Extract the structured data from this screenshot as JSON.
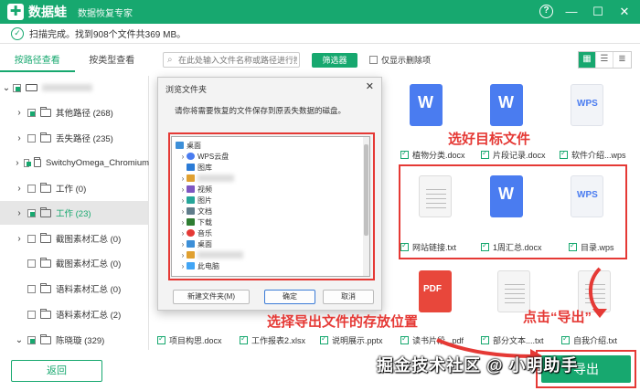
{
  "app": {
    "brand": "数据蛙",
    "subtitle": "数据恢复专家",
    "logo_glyph": "✚",
    "accent_color": "#17a86f",
    "window_buttons": [
      "?",
      "—",
      "☐",
      "✕"
    ]
  },
  "status": {
    "text": "扫描完成。找到908个文件共369 MB。"
  },
  "tabs": [
    "按路径查看",
    "按类型查看"
  ],
  "toolbar": {
    "search_placeholder": "在此处输入文件名称或路径进行搜索",
    "filter_label": "筛选器",
    "only_deleted_label": "仅显示删除项",
    "view_icons": [
      "grid-view-icon",
      "list-view-icon",
      "detail-view-icon"
    ]
  },
  "sidebar": {
    "items": [
      {
        "label": "其他路径 (268)"
      },
      {
        "label": "丢失路径 (235)"
      },
      {
        "label": "SwitchyOmega_Chromium"
      },
      {
        "label": "工作 (0)"
      },
      {
        "label": "工作 (23)"
      },
      {
        "label": "截图素材汇总 (0)"
      },
      {
        "label": "截图素材汇总 (0)"
      },
      {
        "label": "语料素材汇总 (0)"
      },
      {
        "label": "语料素材汇总 (2)"
      },
      {
        "label": "陈晓璇 (329)"
      }
    ],
    "back_label": "返回"
  },
  "files": {
    "row1_names": [
      "植物分类.docx",
      "片段记录.docx",
      "软件介绍...wps"
    ],
    "row2_names": [
      "网站链接.txt",
      "1周汇总.docx",
      "目录.wps"
    ],
    "row3_names": [
      "项目构思.docx",
      "工作报表2.xlsx",
      "说明展示.pptx",
      "读书片段...pdf",
      "部分文本....txt",
      "自我介绍.txt"
    ],
    "icon_text": {
      "wps": "WPS",
      "w": "W",
      "pdf": "PDF"
    }
  },
  "dialog": {
    "title": "浏览文件夹",
    "close": "✕",
    "message": "请你将需要恢复的文件保存到原丢失数据的磁盘。",
    "tree": [
      "桌面",
      "WPS云盘",
      "图库",
      "视频",
      "图片",
      "文档",
      "下载",
      "音乐",
      "桌面",
      "此电脑"
    ],
    "new_folder_label": "新建文件夹(M)",
    "ok_label": "确定",
    "cancel_label": "取消"
  },
  "annotations": {
    "select_target": "选好目标文件",
    "choose_location": "选择导出文件的存放位置",
    "click_export": "点击“导出”",
    "color": "#e53935"
  },
  "export_label": "导出",
  "watermark": "掘金技术社区 @ 小明助手"
}
